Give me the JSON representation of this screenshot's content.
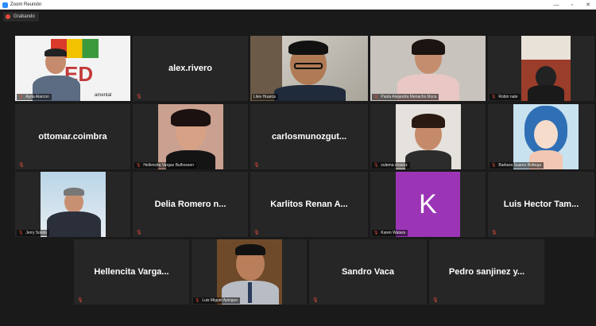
{
  "window": {
    "title": "Zoom Reunión",
    "min": "—",
    "max": "▫",
    "close": "✕"
  },
  "recording": {
    "label": "Grabando"
  },
  "participants": {
    "p1": {
      "name": "Ayda Alarcon",
      "overlay": "amental"
    },
    "p2": {
      "name": "alex.rivero"
    },
    "p3": {
      "name": "Lliev Huarca"
    },
    "p4": {
      "name": "Paola Alejandra Menacho Roca"
    },
    "p5": {
      "name": "Robin nate"
    },
    "p6": {
      "name": "ottomar.coimbra"
    },
    "p7": {
      "name": "Hellencita Vargas Bulhossen"
    },
    "p8": {
      "name": "carlosmunozgut..."
    },
    "p9": {
      "name": "zulema chavez"
    },
    "p10": {
      "name": "Barbara Suarez Bottega"
    },
    "p11": {
      "name": "Jerry Soleto"
    },
    "p12": {
      "name": "Delia Romero n..."
    },
    "p13": {
      "name": "Karlitos Renan A..."
    },
    "p14": {
      "name": "Karen Watara",
      "initial": "K"
    },
    "p15": {
      "name": "Luis Hector Tam..."
    },
    "p16": {
      "name": "Hellencita Varga..."
    },
    "p17": {
      "name": "Luis Miguel Apingue"
    },
    "p18": {
      "name": "Sandro Vaca"
    },
    "p19": {
      "name": "Pedro sanjinez y..."
    }
  },
  "icons": {
    "mic_muted": "mic-muted-icon",
    "zoom_logo": "zoom-logo-icon",
    "record": "record-dot-icon"
  },
  "colors": {
    "active_speaker": "#cde35a",
    "avatar_k": "#9b35b6",
    "muted": "#e84b3c"
  }
}
